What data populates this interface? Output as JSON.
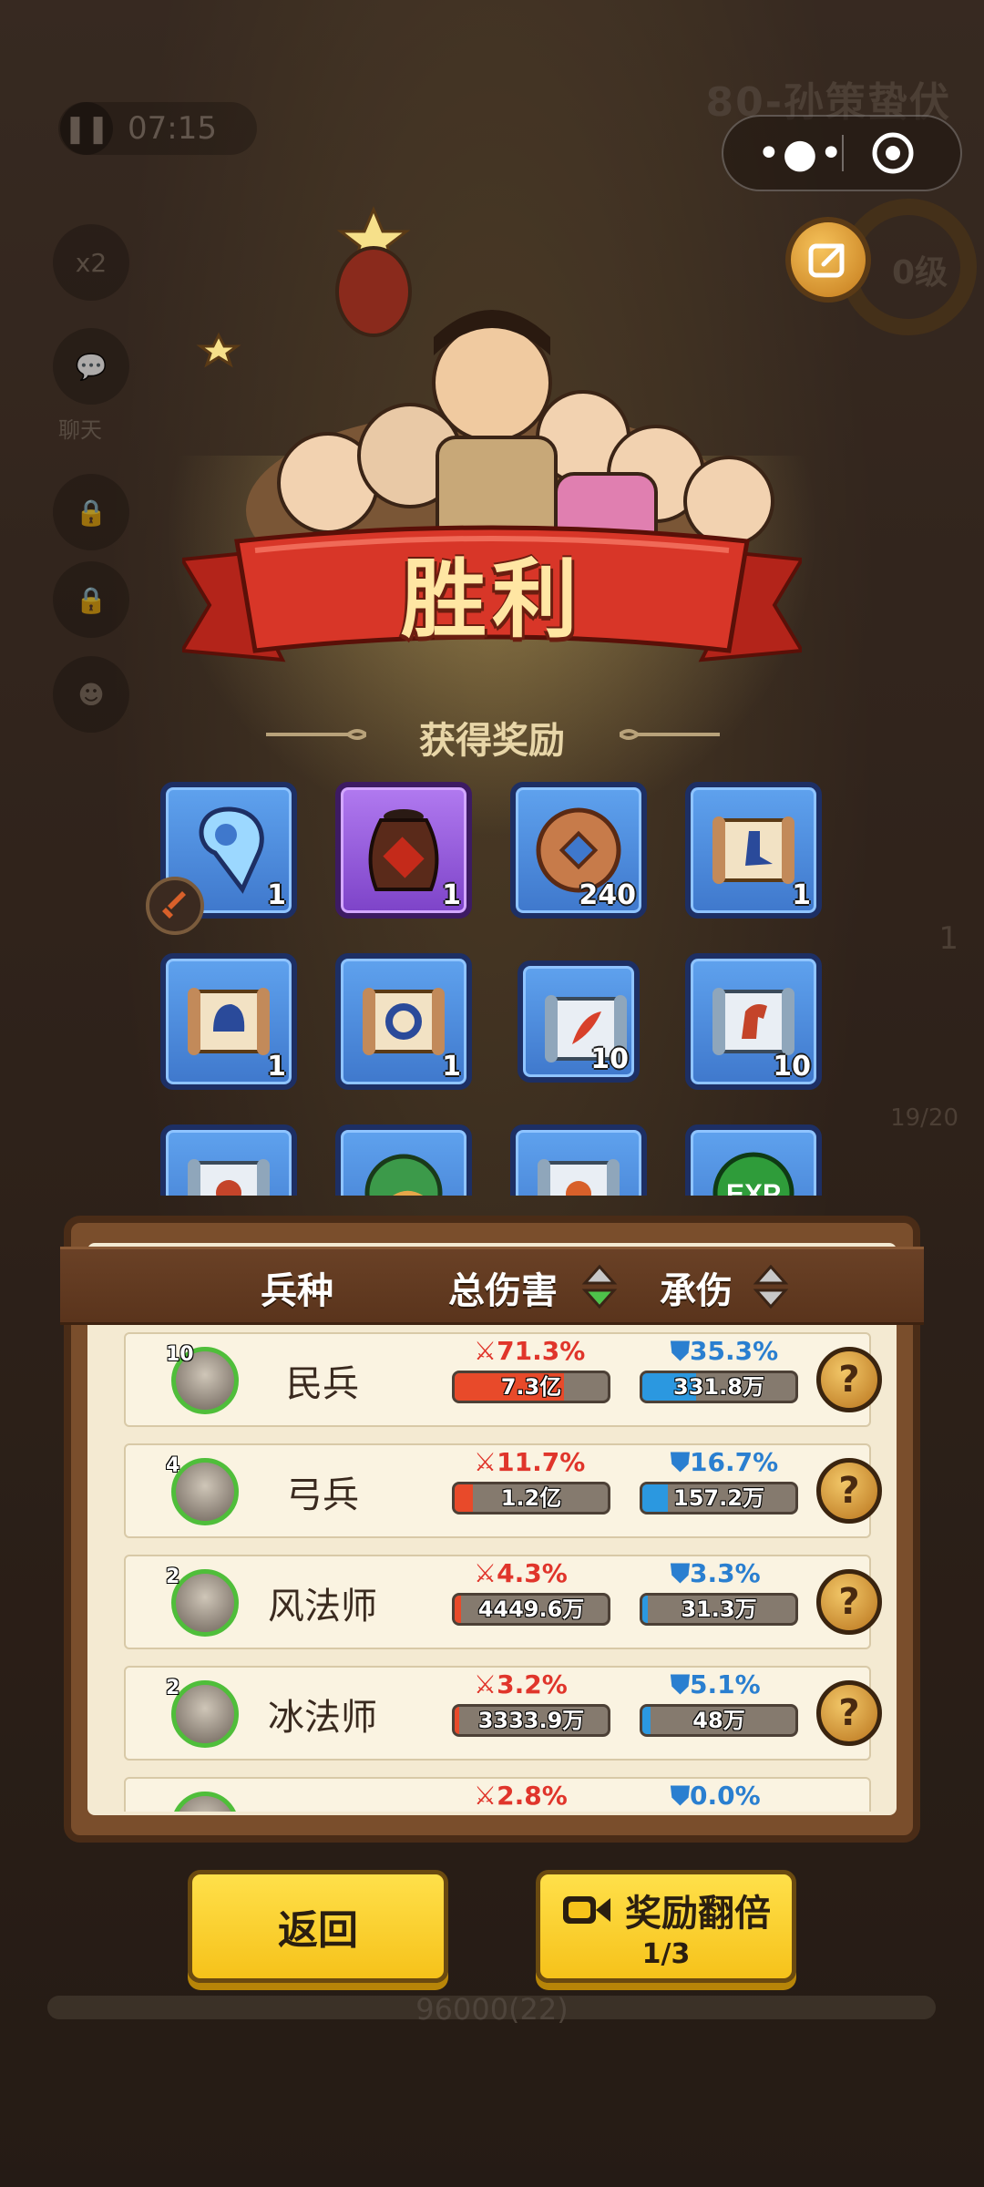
{
  "hud": {
    "time": "07:15",
    "speed": "x2",
    "chat_label": "聊天",
    "stage_title": "80-孙策蛰伏",
    "level_text": "0级",
    "right_count": "1",
    "troops": "19/20",
    "progress_label": "96000(22)"
  },
  "victory": {
    "title": "胜利",
    "reward_title": "获得奖励"
  },
  "rewards": [
    {
      "icon": "blue-gem-icon",
      "count": "1"
    },
    {
      "icon": "wine-jar-icon",
      "count": "1"
    },
    {
      "icon": "copper-coin-icon",
      "count": "240"
    },
    {
      "icon": "boot-scroll-icon",
      "count": "1"
    },
    {
      "icon": "helmet-scroll-icon",
      "count": "1"
    },
    {
      "icon": "ring-scroll-icon",
      "count": "1"
    },
    {
      "icon": "feather-scroll-icon",
      "count": "10"
    },
    {
      "icon": "horse-scroll-icon",
      "count": "10"
    },
    {
      "icon": "red-scroll-icon",
      "count": ""
    },
    {
      "icon": "green-orb-icon",
      "count": ""
    },
    {
      "icon": "tiger-scroll-icon",
      "count": ""
    },
    {
      "icon": "exp-orb-icon",
      "count": ""
    }
  ],
  "stats": {
    "headers": {
      "unit": "兵种",
      "damage": "总伤害",
      "tank": "承伤"
    },
    "rows": [
      {
        "level": "10",
        "name": "民兵",
        "damage_pct": "71.3%",
        "damage_val": "7.3亿",
        "damage_frac": 0.713,
        "tank_pct": "35.3%",
        "tank_val": "331.8万",
        "tank_frac": 0.353
      },
      {
        "level": "4",
        "name": "弓兵",
        "damage_pct": "11.7%",
        "damage_val": "1.2亿",
        "damage_frac": 0.117,
        "tank_pct": "16.7%",
        "tank_val": "157.2万",
        "tank_frac": 0.167
      },
      {
        "level": "2",
        "name": "风法师",
        "damage_pct": "4.3%",
        "damage_val": "4449.6万",
        "damage_frac": 0.043,
        "tank_pct": "3.3%",
        "tank_val": "31.3万",
        "tank_frac": 0.033
      },
      {
        "level": "2",
        "name": "冰法师",
        "damage_pct": "3.2%",
        "damage_val": "3333.9万",
        "damage_frac": 0.032,
        "tank_pct": "5.1%",
        "tank_val": "48万",
        "tank_frac": 0.051
      },
      {
        "level": "",
        "name": "",
        "damage_pct": "2.8%",
        "damage_val": "",
        "damage_frac": 0.028,
        "tank_pct": "0.0%",
        "tank_val": "",
        "tank_frac": 0.0
      }
    ]
  },
  "buttons": {
    "back": "返回",
    "double": "奖励翻倍",
    "double_count": "1/3"
  },
  "colors": {
    "damage": "#e84a2a",
    "tank": "#2b98e0",
    "button": "#f6c21a"
  }
}
